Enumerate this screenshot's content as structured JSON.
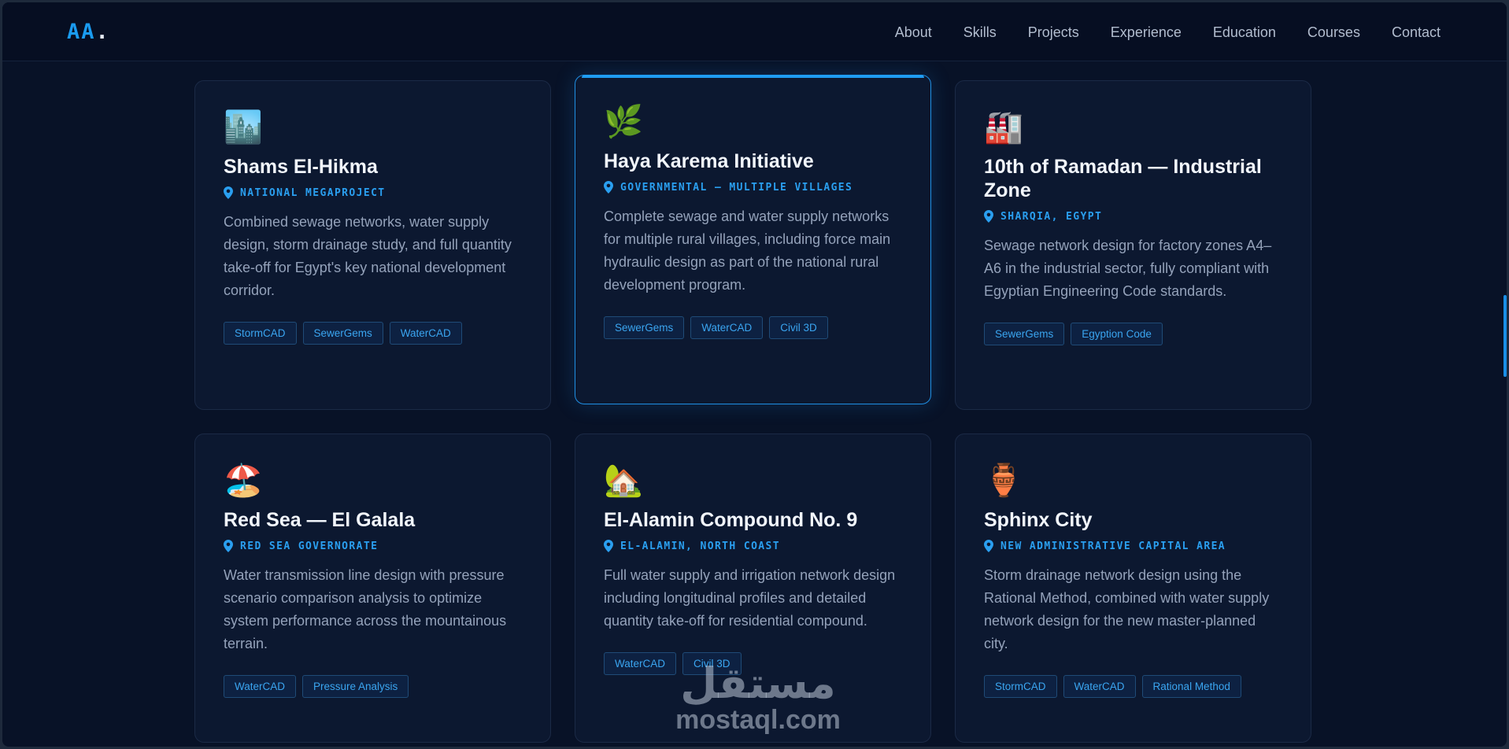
{
  "nav": {
    "logo": "AA",
    "logo_dot": ".",
    "links": [
      "About",
      "Skills",
      "Projects",
      "Experience",
      "Education",
      "Courses",
      "Contact"
    ]
  },
  "colors": {
    "accent": "#1a9bf0",
    "background": "#081227",
    "card": "#0c1830"
  },
  "projects": [
    {
      "icon": "🏙️",
      "title": "Shams El-Hikma",
      "location": "NATIONAL MEGAPROJECT",
      "description": "Combined sewage networks, water supply design, storm drainage study, and full quantity take-off for Egypt's key national development corridor.",
      "tags": [
        "StormCAD",
        "SewerGems",
        "WaterCAD"
      ]
    },
    {
      "icon": "🌿",
      "title": "Haya Karema Initiative",
      "location": "GOVERNMENTAL — MULTIPLE VILLAGES",
      "description": "Complete sewage and water supply networks for multiple rural villages, including force main hydraulic design as part of the national rural development program.",
      "tags": [
        "SewerGems",
        "WaterCAD",
        "Civil 3D"
      ]
    },
    {
      "icon": "🏭",
      "title": "10th of Ramadan — Industrial Zone",
      "location": "SHARQIA, EGYPT",
      "description": "Sewage network design for factory zones A4–A6 in the industrial sector, fully compliant with Egyptian Engineering Code standards.",
      "tags": [
        "SewerGems",
        "Egyption Code"
      ]
    },
    {
      "icon": "🏖️",
      "title": "Red Sea — El Galala",
      "location": "RED SEA GOVERNORATE",
      "description": "Water transmission line design with pressure scenario comparison analysis to optimize system performance across the mountainous terrain.",
      "tags": [
        "WaterCAD",
        "Pressure Analysis"
      ]
    },
    {
      "icon": "🏡",
      "title": "El-Alamin Compound No. 9",
      "location": "EL-ALAMIN, NORTH COAST",
      "description": "Full water supply and irrigation network design including longitudinal profiles and detailed quantity take-off for residential compound.",
      "tags": [
        "WaterCAD",
        "Civil 3D"
      ]
    },
    {
      "icon": "🏺",
      "title": "Sphinx City",
      "location": "NEW ADMINISTRATIVE CAPITAL AREA",
      "description": "Storm drainage network design using the Rational Method, combined with water supply network design for the new master-planned city.",
      "tags": [
        "StormCAD",
        "WaterCAD",
        "Rational Method"
      ]
    }
  ],
  "watermark": {
    "arabic": "مستقل",
    "latin": "mostaql.com"
  }
}
